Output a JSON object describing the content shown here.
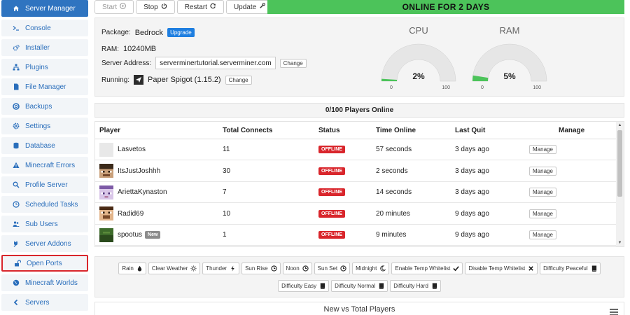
{
  "sidebar": {
    "items": [
      {
        "label": "Server Manager",
        "icon": "home-icon"
      },
      {
        "label": "Console",
        "icon": "terminal-icon"
      },
      {
        "label": "Installer",
        "icon": "cogs-icon"
      },
      {
        "label": "Plugins",
        "icon": "sitemap-icon"
      },
      {
        "label": "File Manager",
        "icon": "file-icon"
      },
      {
        "label": "Backups",
        "icon": "lifebuoy-icon"
      },
      {
        "label": "Settings",
        "icon": "gear-icon"
      },
      {
        "label": "Database",
        "icon": "database-icon"
      },
      {
        "label": "Minecraft Errors",
        "icon": "warning-icon"
      },
      {
        "label": "Profile Server",
        "icon": "search-icon"
      },
      {
        "label": "Scheduled Tasks",
        "icon": "clock-icon"
      },
      {
        "label": "Sub Users",
        "icon": "users-icon"
      },
      {
        "label": "Server Addons",
        "icon": "plug-icon"
      },
      {
        "label": "Open Ports",
        "icon": "unlock-icon"
      },
      {
        "label": "Minecraft Worlds",
        "icon": "globe-icon"
      },
      {
        "label": "Servers",
        "icon": "chevron-left-icon"
      }
    ]
  },
  "toolbar": {
    "start_label": "Start",
    "stop_label": "Stop",
    "restart_label": "Restart",
    "update_label": "Update",
    "status_banner": "ONLINE FOR 2 DAYS"
  },
  "info": {
    "package_label": "Package:",
    "package_value": "Bedrock",
    "upgrade_label": "Upgrade",
    "ram_label": "RAM:",
    "ram_value": "10240MB",
    "address_label": "Server Address:",
    "address_value": "serverminertutorial.serverminer.com",
    "change_label": "Change",
    "running_label": "Running:",
    "running_value": "Paper Spigot (1.15.2)"
  },
  "gauges": {
    "cpu": {
      "title": "CPU",
      "value": 2,
      "display": "2%",
      "min": "0",
      "max": "100"
    },
    "ram": {
      "title": "RAM",
      "value": 5,
      "display": "5%",
      "min": "0",
      "max": "100"
    }
  },
  "colors": {
    "accent": "#2f74c0",
    "online": "#4cc35a",
    "offline": "#d9262c",
    "gauge_fill": "#4cc35a",
    "gauge_track": "#e6e6e6"
  },
  "players": {
    "header": "0/100 Players Online",
    "columns": [
      "Player",
      "Total Connects",
      "Status",
      "Time Online",
      "Last Quit",
      "Manage"
    ],
    "rows": [
      {
        "name": "Lasvetos",
        "connects": "11",
        "status": "OFFLINE",
        "time_online": "57 seconds",
        "last_quit": "3 days ago",
        "manage": "Manage",
        "avatar": "blank-avatar"
      },
      {
        "name": "ItsJustJoshhh",
        "connects": "30",
        "status": "OFFLINE",
        "time_online": "2 seconds",
        "last_quit": "3 days ago",
        "manage": "Manage",
        "avatar": "skin-dark-avatar"
      },
      {
        "name": "AriettaKynaston",
        "connects": "7",
        "status": "OFFLINE",
        "time_online": "14 seconds",
        "last_quit": "3 days ago",
        "manage": "Manage",
        "avatar": "skin-purple-avatar"
      },
      {
        "name": "Radid69",
        "connects": "10",
        "status": "OFFLINE",
        "time_online": "20 minutes",
        "last_quit": "9 days ago",
        "manage": "Manage",
        "avatar": "skin-tan-avatar"
      },
      {
        "name": "spootus",
        "badge": "New",
        "connects": "1",
        "status": "OFFLINE",
        "time_online": "9 minutes",
        "last_quit": "9 days ago",
        "manage": "Manage",
        "avatar": "skin-green-avatar"
      }
    ]
  },
  "controls": {
    "row1": [
      {
        "label": "Rain",
        "icon": "tint-icon"
      },
      {
        "label": "Clear Weather",
        "icon": "sun-icon"
      },
      {
        "label": "Thunder",
        "icon": "bolt-icon"
      },
      {
        "label": "Sun Rise",
        "icon": "clock-icon"
      },
      {
        "label": "Noon",
        "icon": "clock-icon"
      },
      {
        "label": "Sun Set",
        "icon": "clock-icon"
      },
      {
        "label": "Midnight",
        "icon": "moon-icon"
      },
      {
        "label": "Enable Temp Whitelist",
        "icon": "check-icon"
      },
      {
        "label": "Disable Temp Whitelist",
        "icon": "times-icon"
      },
      {
        "label": "Difficulty Peaceful",
        "icon": "book-icon"
      }
    ],
    "row2": [
      {
        "label": "Difficulty Easy",
        "icon": "book-icon"
      },
      {
        "label": "Difficulty Normal",
        "icon": "book-icon"
      },
      {
        "label": "Difficulty Hard",
        "icon": "book-icon"
      }
    ]
  },
  "chart_section": {
    "title": "New vs Total Players"
  }
}
